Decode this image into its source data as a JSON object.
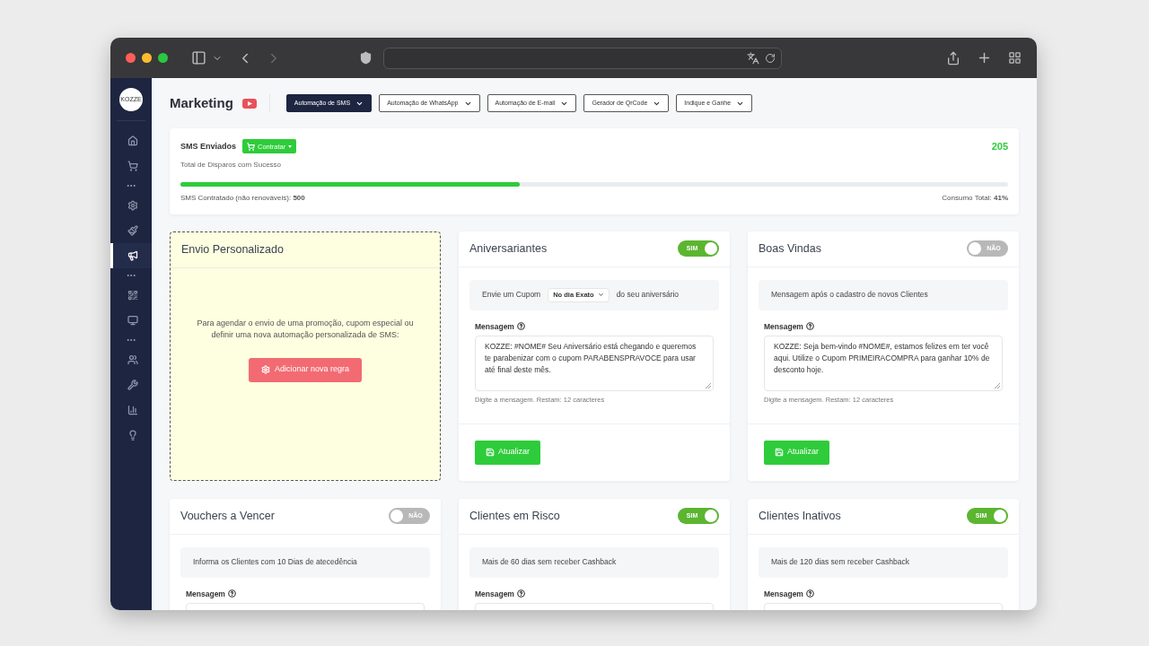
{
  "sidebar": {
    "logo": "KOZZE",
    "items": [
      {
        "kind": "icon",
        "selected": false
      },
      {
        "kind": "icon",
        "selected": false
      },
      {
        "kind": "dots"
      },
      {
        "kind": "icon",
        "selected": false
      },
      {
        "kind": "icon",
        "selected": false
      },
      {
        "kind": "icon",
        "selected": true
      },
      {
        "kind": "dots"
      },
      {
        "kind": "icon",
        "selected": false
      },
      {
        "kind": "icon",
        "selected": false
      },
      {
        "kind": "dots"
      },
      {
        "kind": "icon",
        "selected": false
      },
      {
        "kind": "icon",
        "selected": false
      },
      {
        "kind": "icon",
        "selected": false
      },
      {
        "kind": "icon",
        "selected": false
      }
    ]
  },
  "header": {
    "title": "Marketing",
    "tabs": [
      {
        "label": "Automação de SMS",
        "selected": true
      },
      {
        "label": "Automação de WhatsApp",
        "selected": false
      },
      {
        "label": "Automação de E-mail",
        "selected": false
      },
      {
        "label": "Gerador de QrCode",
        "selected": false
      },
      {
        "label": "Indique e Ganhe",
        "selected": false
      }
    ]
  },
  "sms_card": {
    "title": "SMS Enviados",
    "button": "Contratar",
    "count": "205",
    "subtitle": "Total de Disparos com Sucesso",
    "level": 0.41,
    "contracted": "SMS Contratado (não renováveis): **500**",
    "consumption": "Consumo Total: **41%**"
  },
  "cards": [
    {
      "kind": "custom",
      "title": "Envio Personalizado",
      "text": "Para agendar o envio de uma promoção, cupom especial ou definir uma nova automação personalizada de SMS:",
      "button": "Adicionar nova regra"
    },
    {
      "kind": "automation",
      "title": "Aniversariantes",
      "toggle": {
        "on": true,
        "label": "SIM"
      },
      "info": {
        "prefix": "Envie um Cupom",
        "select": "No dia Exato",
        "suffix": "do seu aniversário"
      },
      "message_label": "Mensagem",
      "message": "KOZZE: #NOME# Seu Aniversário está chegando e queremos te parabenizar com o cupom PARABENSPRAVOCE para usar até final deste mês.",
      "hint": "Digite a mensagem. Restam: 12 caracteres",
      "button": "Atualizar"
    },
    {
      "kind": "automation",
      "title": "Boas Vindas",
      "toggle": {
        "on": false,
        "label": "NÃO"
      },
      "info": {
        "text": "Mensagem após o cadastro de novos Clientes"
      },
      "message_label": "Mensagem",
      "message": "KOZZE: Seja bem-vindo #NOME#, estamos felizes em ter você aqui. Utilize o Cupom PRIMEIRACOMPRA para ganhar 10% de desconto hoje.",
      "hint": "Digite a mensagem. Restam: 12 caracteres",
      "button": "Atualizar"
    },
    {
      "kind": "automation",
      "title": "Vouchers a Vencer",
      "toggle": {
        "on": false,
        "label": "NÃO"
      },
      "info": {
        "text": "Informa os Clientes com 10 Dias de atecedência"
      },
      "message_label": "Mensagem"
    },
    {
      "kind": "automation",
      "title": "Clientes em Risco",
      "toggle": {
        "on": true,
        "label": "SIM"
      },
      "info": {
        "text": "Mais de 60 dias sem receber Cashback"
      },
      "message_label": "Mensagem"
    },
    {
      "kind": "automation",
      "title": "Clientes Inativos",
      "toggle": {
        "on": true,
        "label": "SIM"
      },
      "info": {
        "text": "Mais de 120 dias sem receber Cashback"
      },
      "message_label": "Mensagem"
    }
  ]
}
